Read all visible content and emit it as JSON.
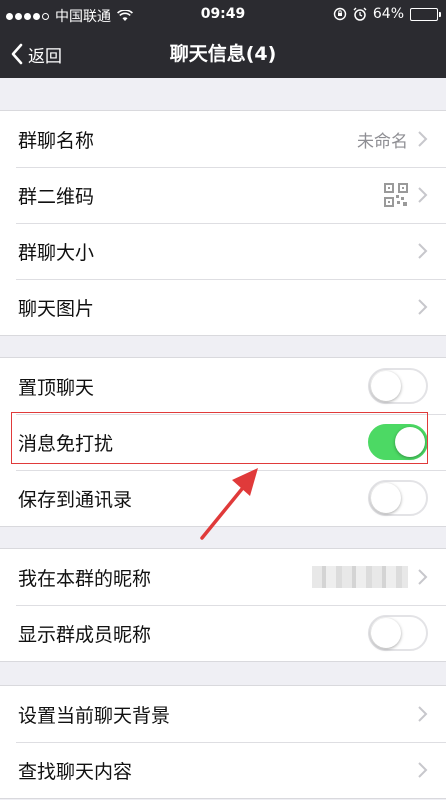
{
  "status_bar": {
    "carrier": "中国联通",
    "time": "09:49",
    "battery_percent": "64%",
    "battery_level": 0.64,
    "signal_icon": "signal-dots-icon",
    "wifi_icon": "wifi-icon",
    "rotation_lock_icon": "rotation-lock-icon",
    "alarm_icon": "alarm-icon"
  },
  "nav": {
    "back_label": "返回",
    "title": "聊天信息(4)"
  },
  "groups": [
    {
      "rows": [
        {
          "label": "群聊名称",
          "value": "未命名",
          "type": "chevron"
        },
        {
          "label": "群二维码",
          "type": "qr"
        },
        {
          "label": "群聊大小",
          "type": "chevron"
        },
        {
          "label": "聊天图片",
          "type": "chevron"
        }
      ]
    },
    {
      "rows": [
        {
          "label": "置顶聊天",
          "type": "switch",
          "on": false
        },
        {
          "label": "消息免打扰",
          "type": "switch",
          "on": true
        },
        {
          "label": "保存到通讯录",
          "type": "switch",
          "on": false
        }
      ]
    },
    {
      "rows": [
        {
          "label": "我在本群的昵称",
          "type": "blurred"
        },
        {
          "label": "显示群成员昵称",
          "type": "switch",
          "on": false
        }
      ]
    },
    {
      "rows": [
        {
          "label": "设置当前聊天背景",
          "type": "chevron"
        },
        {
          "label": "查找聊天内容",
          "type": "chevron"
        }
      ]
    }
  ],
  "colors": {
    "nav_bg": "#2b2b30",
    "page_bg": "#efeff4",
    "switch_on": "#4cd964",
    "highlight": "#e03a3a"
  }
}
